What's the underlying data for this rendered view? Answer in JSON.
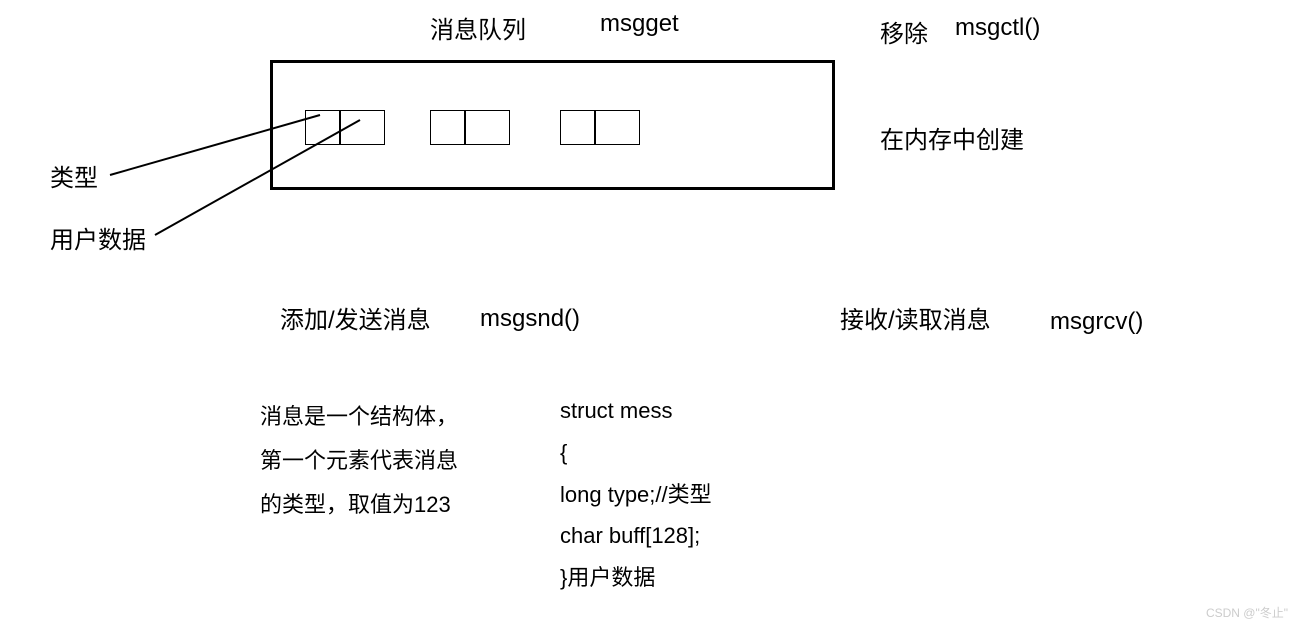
{
  "header": {
    "title": "消息队列",
    "func_get": "msgget",
    "remove_label": "移除",
    "func_ctl": "msgctl()"
  },
  "right_label": "在内存中创建",
  "left_labels": {
    "type": "类型",
    "userdata": "用户数据"
  },
  "mid": {
    "send_label": "添加/发送消息",
    "send_func": "msgsnd()",
    "recv_label": "接收/读取消息",
    "recv_func": "msgrcv()"
  },
  "desc": {
    "line1": "消息是一个结构体，",
    "line2": "第一个元素代表消息",
    "line3": "的类型，取值为123"
  },
  "code": {
    "l1": "struct  mess",
    "l2": "{",
    "l3": "long type;//类型",
    "l4": "char buff[128];",
    "l5": "}用户数据"
  },
  "watermark": "CSDN @\"冬止\""
}
